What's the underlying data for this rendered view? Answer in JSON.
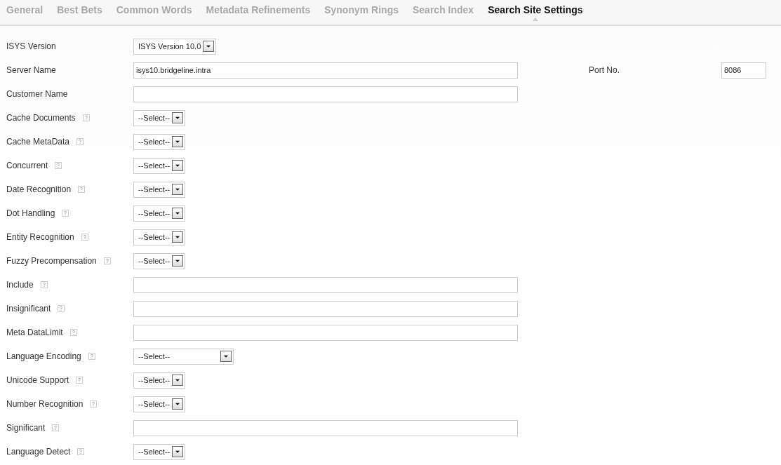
{
  "tabs": [
    {
      "label": "General",
      "selected": false
    },
    {
      "label": "Best Bets",
      "selected": false
    },
    {
      "label": "Common Words",
      "selected": false
    },
    {
      "label": "Metadata Refinements",
      "selected": false
    },
    {
      "label": "Synonym Rings",
      "selected": false
    },
    {
      "label": "Search Index",
      "selected": false
    },
    {
      "label": "Search Site Settings",
      "selected": true
    }
  ],
  "fields": [
    {
      "label": "ISYS Version",
      "help": false,
      "kind": "select",
      "value": "ISYS Version 10.0"
    },
    {
      "label": "Server Name",
      "help": false,
      "kind": "text",
      "value": "isys10.bridgeline.intra",
      "extra": {
        "label": "Port No.",
        "value": "8086"
      }
    },
    {
      "label": "Customer Name",
      "help": false,
      "kind": "text"
    },
    {
      "label": "Cache Documents",
      "help": true,
      "kind": "select",
      "value": "--Select--"
    },
    {
      "label": "Cache MetaData",
      "help": true,
      "kind": "select",
      "value": "--Select--"
    },
    {
      "label": "Concurrent",
      "help": true,
      "kind": "select",
      "value": "--Select--"
    },
    {
      "label": "Date Recognition",
      "help": true,
      "kind": "select",
      "value": "--Select--"
    },
    {
      "label": "Dot Handling",
      "help": true,
      "kind": "select",
      "value": "--Select--"
    },
    {
      "label": "Entity Recognition",
      "help": true,
      "kind": "select",
      "value": "--Select--"
    },
    {
      "label": "Fuzzy Precompensation",
      "help": true,
      "kind": "select",
      "value": "--Select--"
    },
    {
      "label": "Include",
      "help": true,
      "kind": "text"
    },
    {
      "label": "Insignificant",
      "help": true,
      "kind": "text"
    },
    {
      "label": "Meta DataLimit",
      "help": true,
      "kind": "text"
    },
    {
      "label": "Language Encoding",
      "help": true,
      "kind": "longselect",
      "value": "--Select--"
    },
    {
      "label": "Unicode Support",
      "help": true,
      "kind": "select",
      "value": "--Select--"
    },
    {
      "label": "Number Recognition",
      "help": true,
      "kind": "select",
      "value": "--Select--"
    },
    {
      "label": "Significant",
      "help": true,
      "kind": "text"
    },
    {
      "label": "Language Detect",
      "help": true,
      "kind": "select",
      "value": "--Select--"
    }
  ]
}
